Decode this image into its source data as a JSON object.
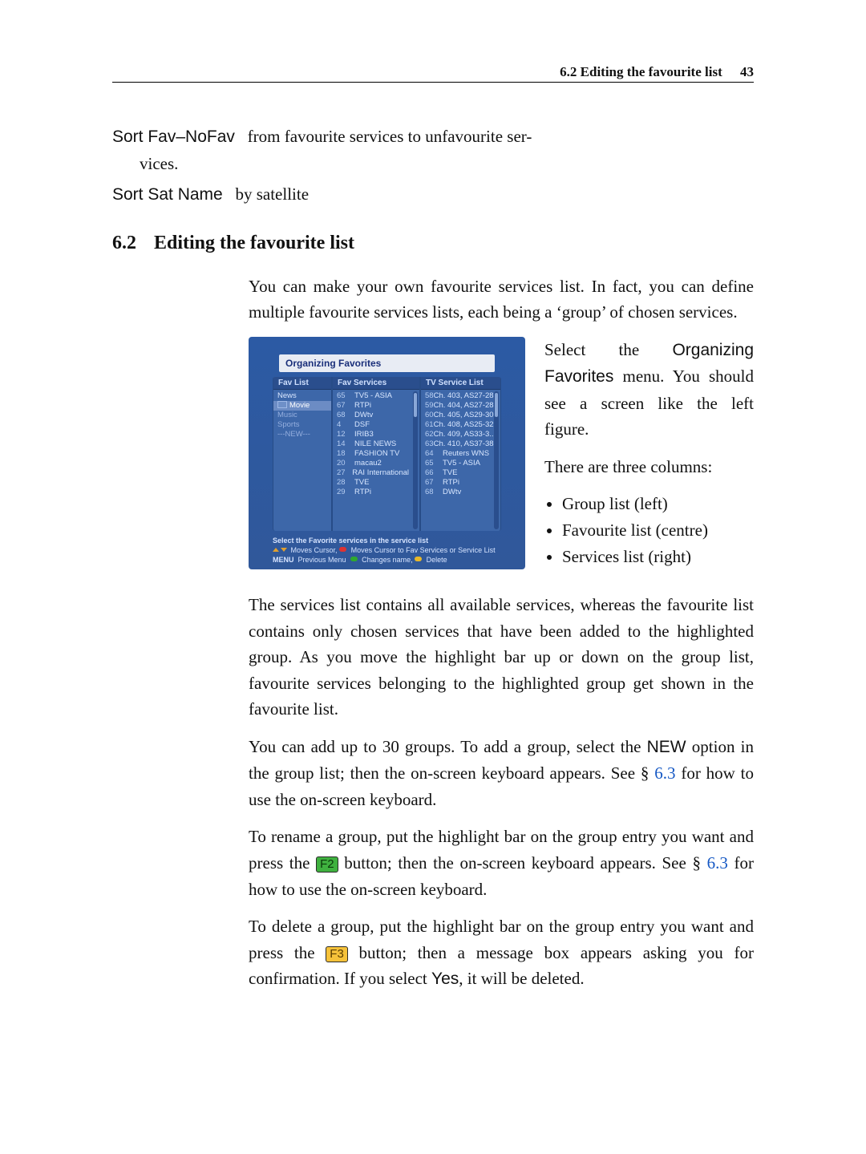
{
  "header": {
    "running_head": "6.2 Editing the favourite list",
    "page_number": "43"
  },
  "defs": {
    "sort_favnofav_term": "Sort Fav–NoFav",
    "sort_favnofav_desc_line1": "from favourite services to unfavourite ser-",
    "sort_favnofav_desc_line2": "vices.",
    "sort_satname_term": "Sort Sat Name",
    "sort_satname_desc": "by satellite"
  },
  "section": {
    "number": "6.2",
    "title": "Editing the favourite list"
  },
  "intro": "You can make your own favourite services list. In fact, you can define multiple favourite services lists, each being a ‘group’ of chosen services.",
  "side": {
    "p1a": "Select the ",
    "p1_ui": "Organizing Favorites",
    "p1b": " menu. You should see a screen like the left figure.",
    "p2": "There are three columns:",
    "li1": "Group list (left)",
    "li2": "Favourite list (centre)",
    "li3": "Services list (right)"
  },
  "body_after": {
    "p1": "The services list contains all available services, whereas the favourite list contains only chosen services that have been added to the highlighted group. As you move the highlight bar up or down on the group list, favourite services belonging to the highlighted group get shown in the favourite list.",
    "p2a": "You can add up to 30 groups. To add a group, select the ",
    "p2_ui": "NEW",
    "p2b": " option in the group list; then the on-screen keyboard appears. See § ",
    "p2_link": "6.3",
    "p2c": " for how to use the on-screen keyboard.",
    "p3a": "To rename a group, put the highlight bar on the group entry you want and press the ",
    "p3_key": "F2",
    "p3b": " button; then the on-screen keyboard appears. See § ",
    "p3_link": "6.3",
    "p3c": " for how to use the on-screen keyboard.",
    "p4a": "To delete a group, put the highlight bar on the group entry you want and press the ",
    "p4_key": "F3",
    "p4b": " button; then a message box appears asking you for confirmation. If you select ",
    "p4_ui": "Yes",
    "p4c": ", it will be deleted."
  },
  "of_ui": {
    "title": "Organizing Favorites",
    "col1_head": "Fav List",
    "col2_head": "Fav Services",
    "col3_head": "TV Service List",
    "groups": [
      {
        "label": "News",
        "sel": false
      },
      {
        "label": "Movie",
        "sel": true,
        "icon": true
      },
      {
        "label": "Music",
        "sel": false,
        "dim": true
      },
      {
        "label": "Sports",
        "sel": false,
        "dim": true
      },
      {
        "label": "---NEW---",
        "sel": false,
        "dim": true
      }
    ],
    "fav_services": [
      {
        "n": "65",
        "t": "TV5 - ASIA"
      },
      {
        "n": "67",
        "t": "RTPi"
      },
      {
        "n": "68",
        "t": "DWtv"
      },
      {
        "n": "4",
        "t": "DSF"
      },
      {
        "n": "12",
        "t": "IRIB3"
      },
      {
        "n": "14",
        "t": "NILE NEWS"
      },
      {
        "n": "18",
        "t": "FASHION TV"
      },
      {
        "n": "20",
        "t": "macau2"
      },
      {
        "n": "27",
        "t": "RAI International"
      },
      {
        "n": "28",
        "t": "TVE"
      },
      {
        "n": "29",
        "t": "RTPi"
      }
    ],
    "tv_services": [
      {
        "n": "58",
        "t": "Ch. 403, AS27-28..."
      },
      {
        "n": "59",
        "t": "Ch. 404, AS27-28..."
      },
      {
        "n": "60",
        "t": "Ch. 405, AS29-30..."
      },
      {
        "n": "61",
        "t": "Ch. 408, AS25-32"
      },
      {
        "n": "62",
        "t": "Ch. 409, AS33-3..."
      },
      {
        "n": "63",
        "t": "Ch. 410, AS37-38..."
      },
      {
        "n": "64",
        "t": "Reuters WNS"
      },
      {
        "n": "65",
        "t": "TV5 - ASIA"
      },
      {
        "n": "66",
        "t": "TVE"
      },
      {
        "n": "67",
        "t": "RTPi"
      },
      {
        "n": "68",
        "t": "DWtv"
      }
    ],
    "footer1": "Select the Favorite services in the service list",
    "footer2a": "Moves Cursor,",
    "footer2b": "Moves Cursor to Fav Services or Service List",
    "footer3a": "MENU",
    "footer3b": "Previous Menu",
    "footer3c": "Changes name,",
    "footer3d": "Delete"
  }
}
